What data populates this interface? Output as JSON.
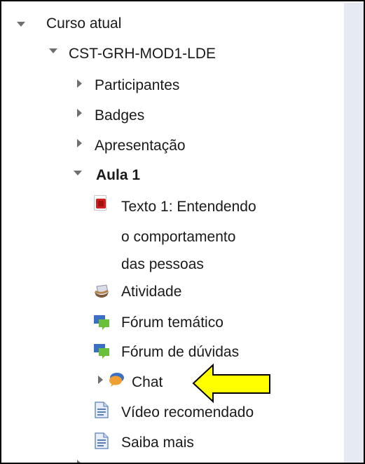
{
  "tree": {
    "root": {
      "label": "Curso atual"
    },
    "course": {
      "label": "CST-GRH-MOD1-LDE"
    },
    "sections": [
      {
        "label": "Participantes"
      },
      {
        "label": "Badges"
      },
      {
        "label": "Apresentação"
      }
    ],
    "aula": {
      "label": "Aula 1",
      "items": [
        {
          "label_lines": [
            "Texto 1: Entendendo",
            "o comportamento",
            "das pessoas"
          ],
          "icon": "pdf-icon"
        },
        {
          "label": "Atividade",
          "icon": "assignment-icon"
        },
        {
          "label": "Fórum temático",
          "icon": "forum-icon"
        },
        {
          "label": "Fórum de dúvidas",
          "icon": "forum-icon"
        },
        {
          "label": "Chat",
          "icon": "chat-icon"
        },
        {
          "label": "Vídeo recomendado",
          "icon": "page-icon"
        },
        {
          "label": "Saiba mais",
          "icon": "page-icon"
        }
      ]
    }
  },
  "colors": {
    "arrow_fill": "#ffff00",
    "right_panel": "#e6eaf2",
    "forum_green": "#6abf3b",
    "forum_blue": "#3b6fc4",
    "chat_orange": "#f0a030"
  }
}
